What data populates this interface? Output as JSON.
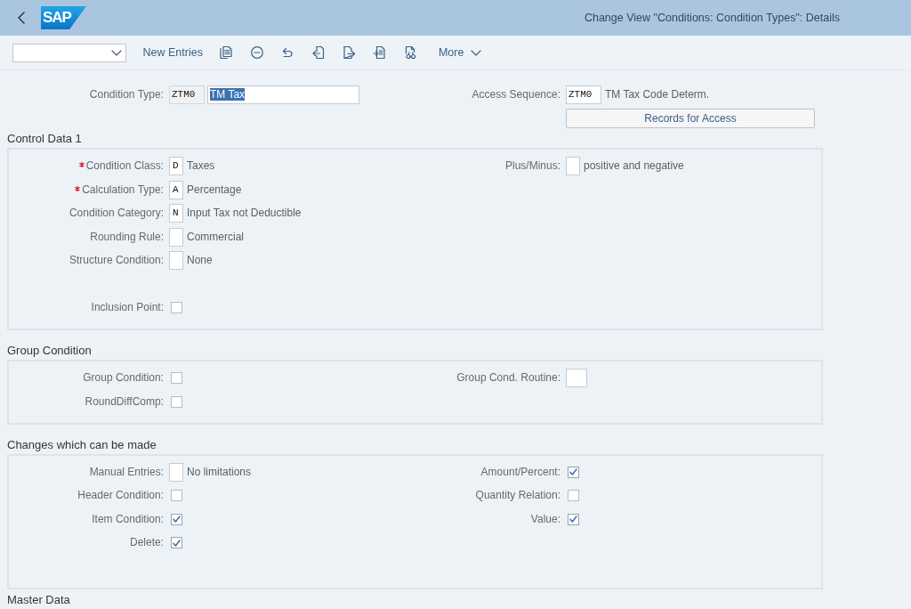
{
  "header": {
    "logo": "SAP",
    "title": "Change View \"Conditions: Condition Types\": Details"
  },
  "toolbar": {
    "new_entries": "New Entries",
    "more": "More"
  },
  "key_fields": {
    "condition_type": {
      "label": "Condition Type:",
      "code": "ZTM0",
      "code_readonly": true,
      "name": "TM Tax",
      "name_selected": true
    },
    "access_sequence": {
      "label": "Access Sequence:",
      "code": "ZTM0",
      "code_readonly": false,
      "description": "TM Tax Code Determ.",
      "button": "Records for Access"
    }
  },
  "sections": [
    {
      "title": "Control Data 1",
      "left": [
        {
          "kind": "code",
          "label": "Condition Class:",
          "required": true,
          "value": "D",
          "description": "Taxes"
        },
        {
          "kind": "code",
          "label": "Calculation Type:",
          "required": true,
          "value": "A",
          "description": "Percentage"
        },
        {
          "kind": "code",
          "label": "Condition Category:",
          "required": false,
          "value": "N",
          "description": "Input Tax not Deductible"
        },
        {
          "kind": "code",
          "label": "Rounding Rule:",
          "required": false,
          "description": "Commercial"
        },
        {
          "kind": "code",
          "label": "Structure Condition:",
          "required": false,
          "description": "None"
        }
      ],
      "right": [
        {
          "kind": "code",
          "label": "Plus/Minus:",
          "required": false,
          "description": "positive and negative"
        }
      ],
      "bottom": [
        {
          "kind": "checkbox",
          "label": "Inclusion Point:",
          "required": false,
          "checked": false
        }
      ]
    },
    {
      "title": "Group Condition",
      "left": [
        {
          "kind": "checkbox",
          "label": "Group Condition:",
          "required": false,
          "checked": false
        },
        {
          "kind": "checkbox",
          "label": "RoundDiffComp:",
          "required": false,
          "checked": false
        }
      ],
      "right": [
        {
          "kind": "input",
          "label": "Group Cond. Routine:",
          "required": false
        }
      ]
    },
    {
      "title": "Changes which can be made",
      "left": [
        {
          "kind": "code",
          "label": "Manual Entries:",
          "required": false,
          "description": "No limitations"
        },
        {
          "kind": "checkbox",
          "label": "Header Condition:",
          "required": false,
          "checked": false
        },
        {
          "kind": "checkbox",
          "label": "Item Condition:",
          "required": false,
          "checked": true
        },
        {
          "kind": "checkbox",
          "label": "Delete:",
          "required": false,
          "checked": true
        }
      ],
      "right": [
        {
          "kind": "checkbox",
          "label": "Amount/Percent:",
          "required": false,
          "checked": true
        },
        {
          "kind": "checkbox",
          "label": "Quantity Relation:",
          "required": false,
          "checked": false
        },
        {
          "kind": "checkbox",
          "label": "Value:",
          "required": false,
          "checked": true
        }
      ]
    },
    {
      "title": "Master Data"
    }
  ]
}
